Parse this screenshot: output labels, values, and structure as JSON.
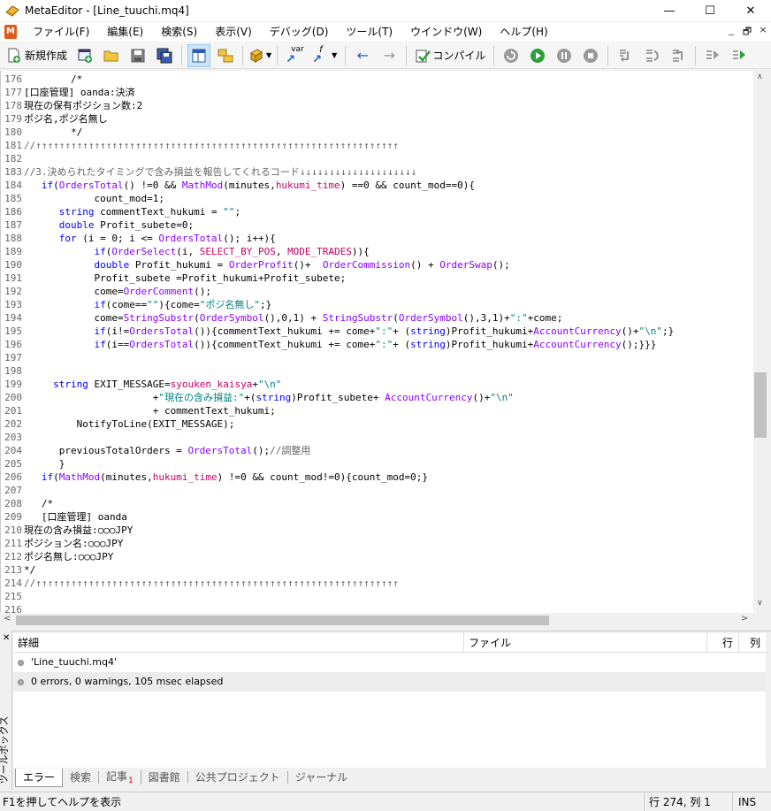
{
  "window": {
    "title": "MetaEditor - [Line_tuuchi.mq4]",
    "minimize": "—",
    "maximize": "☐",
    "close": "✕"
  },
  "menu": {
    "items": [
      "ファイル(F)",
      "編集(E)",
      "検索(S)",
      "表示(V)",
      "デバッグ(D)",
      "ツール(T)",
      "ウインドウ(W)",
      "ヘルプ(H)"
    ],
    "mdi_min": "_",
    "mdi_restore": "🗗",
    "mdi_close": "×"
  },
  "toolbar": {
    "new_label": "新規作成",
    "compile_label": "コンパイル",
    "var_label": "var",
    "f_label": "f"
  },
  "editor": {
    "lines": [
      {
        "n": "176",
        "t": "        /*"
      },
      {
        "n": "177",
        "t": "[口座管理] oanda:決済"
      },
      {
        "n": "178",
        "t": "現在の保有ポジション数:2"
      },
      {
        "n": "179",
        "t": "ポジ名,ポジ名無し"
      },
      {
        "n": "180",
        "t": "        */"
      },
      {
        "n": "181",
        "t": "//↑↑↑↑↑↑↑↑↑↑↑↑↑↑↑↑↑↑↑↑↑↑↑↑↑↑↑↑↑↑↑↑↑↑↑↑↑↑↑↑↑↑↑↑↑↑↑↑↑↑↑↑↑↑↑↑↑↑↑↑↑↑"
      },
      {
        "n": "182",
        "t": ""
      },
      {
        "n": "183",
        "t": "//3.決められたタイミングで含み損益を報告してくれるコード↓↓↓↓↓↓↓↓↓↓↓↓↓↓↓↓↓↓↓↓"
      },
      {
        "n": "184",
        "t": "   if(OrdersTotal() !=0 && MathMod(minutes,hukumi_time) ==0 && count_mod==0){"
      },
      {
        "n": "185",
        "t": "            count_mod=1;"
      },
      {
        "n": "186",
        "t": "      string commentText_hukumi = \"\";"
      },
      {
        "n": "187",
        "t": "      double Profit_subete=0;"
      },
      {
        "n": "188",
        "t": "      for (i = 0; i <= OrdersTotal(); i++){"
      },
      {
        "n": "189",
        "t": "            if(OrderSelect(i, SELECT_BY_POS, MODE_TRADES)){"
      },
      {
        "n": "190",
        "t": "            double Profit_hukumi = OrderProfit()+  OrderCommission() + OrderSwap();"
      },
      {
        "n": "191",
        "t": "            Profit_subete =Profit_hukumi+Profit_subete;"
      },
      {
        "n": "192",
        "t": "            come=OrderComment();"
      },
      {
        "n": "193",
        "t": "            if(come==\"\"){come=\"ポジ名無し\";}"
      },
      {
        "n": "194",
        "t": "            come=StringSubstr(OrderSymbol(),0,1) + StringSubstr(OrderSymbol(),3,1)+\":\"+come;"
      },
      {
        "n": "195",
        "t": "            if(i!=OrdersTotal()){commentText_hukumi += come+\":\"+ (string)Profit_hukumi+AccountCurrency()+\"\\n\";}"
      },
      {
        "n": "196",
        "t": "            if(i==OrdersTotal()){commentText_hukumi += come+\":\"+ (string)Profit_hukumi+AccountCurrency();}}}"
      },
      {
        "n": "197",
        "t": ""
      },
      {
        "n": "198",
        "t": ""
      },
      {
        "n": "199",
        "t": "     string EXIT_MESSAGE=syouken_kaisya+\"\\n\""
      },
      {
        "n": "200",
        "t": "                      +\"現在の含み損益:\"+(string)Profit_subete+ AccountCurrency()+\"\\n\""
      },
      {
        "n": "201",
        "t": "                      + commentText_hukumi;"
      },
      {
        "n": "202",
        "t": "         NotifyToLine(EXIT_MESSAGE);"
      },
      {
        "n": "203",
        "t": ""
      },
      {
        "n": "204",
        "t": "      previousTotalOrders = OrdersTotal();//調整用"
      },
      {
        "n": "205",
        "t": "      }"
      },
      {
        "n": "206",
        "t": "   if(MathMod(minutes,hukumi_time) !=0 && count_mod!=0){count_mod=0;}"
      },
      {
        "n": "207",
        "t": ""
      },
      {
        "n": "208",
        "t": "   /*"
      },
      {
        "n": "209",
        "t": "   [口座管理] oanda"
      },
      {
        "n": "210",
        "t": "現在の含み損益:○○○JPY"
      },
      {
        "n": "211",
        "t": "ポジション名:○○○JPY"
      },
      {
        "n": "212",
        "t": "ポジ名無し:○○○JPY"
      },
      {
        "n": "213",
        "t": "*/"
      },
      {
        "n": "214",
        "t": "//↑↑↑↑↑↑↑↑↑↑↑↑↑↑↑↑↑↑↑↑↑↑↑↑↑↑↑↑↑↑↑↑↑↑↑↑↑↑↑↑↑↑↑↑↑↑↑↑↑↑↑↑↑↑↑↑↑↑↑↑↑↑"
      },
      {
        "n": "215",
        "t": ""
      },
      {
        "n": "216",
        "t": ""
      }
    ]
  },
  "toolbox": {
    "side_label": "ツールボックス",
    "columns": {
      "details": "詳細",
      "file": "ファイル",
      "line": "行",
      "col": "列"
    },
    "rows": [
      {
        "text": "'Line_tuuchi.mq4'"
      },
      {
        "text": "0 errors, 0 warnings, 105 msec elapsed"
      }
    ],
    "tabs": [
      {
        "label": "エラー"
      },
      {
        "label": "検索"
      },
      {
        "label": "記事",
        "badge": "1"
      },
      {
        "label": "図書館"
      },
      {
        "label": "公共プロジェクト"
      },
      {
        "label": "ジャーナル"
      }
    ]
  },
  "status": {
    "help": "F1を押してヘルプを表示",
    "position": "行 274, 列 1",
    "mode": "INS"
  },
  "colors": {
    "keyword": "#0000ff",
    "function": "#8b00ff",
    "string": "#808080",
    "active_tab_bg": "#ffffff",
    "selection": "#cce4f7"
  }
}
